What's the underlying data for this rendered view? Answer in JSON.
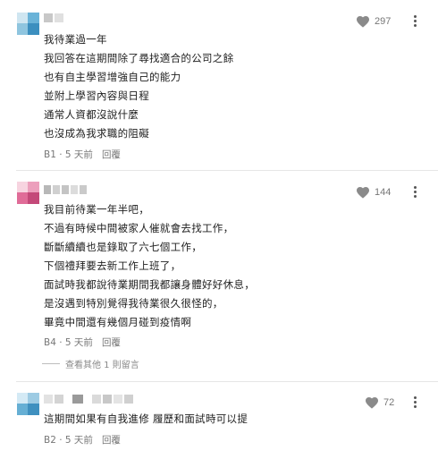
{
  "comments": [
    {
      "floor_label": "B1",
      "time_label": "5 天前",
      "reply_label": "回覆",
      "likes": "297",
      "avatar_colors": [
        "#cfe6f1",
        "#8fc5df",
        "#5aa9d1",
        "#3c8fbf"
      ],
      "lines": [
        "我待業過一年",
        "我回答在這期間除了尋找適合的公司之餘",
        "也有自主學習增強自己的能力",
        "並附上學習內容與日程",
        "通常人資都沒說什麼",
        "也沒成為我求職的阻礙"
      ]
    },
    {
      "floor_label": "B4",
      "time_label": "5 天前",
      "reply_label": "回覆",
      "likes": "144",
      "avatar_colors": [
        "#f7d4e0",
        "#ec9fbc",
        "#e06c98",
        "#c44979"
      ],
      "lines": [
        "我目前待業一年半吧，",
        "不過有時候中間被家人催就會去找工作，",
        "斷斷續續也是錄取了六七個工作，",
        "下個禮拜要去新工作上班了，",
        "面試時我都說待業期間我都讓身體好好休息，",
        "是沒遇到特別覺得我待業很久很怪的，",
        "畢竟中間還有幾個月碰到疫情啊"
      ],
      "more_replies_label": "查看其他 1 則留言"
    },
    {
      "floor_label": "B2",
      "time_label": "5 天前",
      "reply_label": "回覆",
      "likes": "72",
      "avatar_colors": [
        "#d4eaf5",
        "#9dcbe3",
        "#66afd4",
        "#3f90bf"
      ],
      "lines": [
        "這期間如果有自我進修 履歷和面試時可以提"
      ]
    }
  ],
  "icons": {
    "like": "heart-icon",
    "more": "more-vertical-icon"
  },
  "colors": {
    "heart": "#8a8a8a",
    "text": "#1e1e1e",
    "meta": "#777777"
  }
}
